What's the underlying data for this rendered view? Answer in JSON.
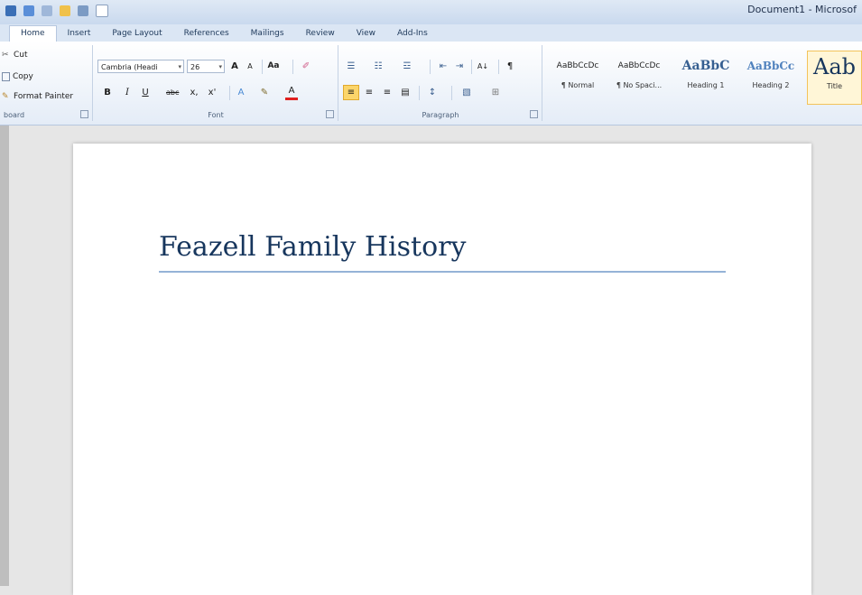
{
  "app": {
    "document_title": "Document1 - Microsof"
  },
  "tabs": [
    "Home",
    "Insert",
    "Page Layout",
    "References",
    "Mailings",
    "Review",
    "View",
    "Add-Ins"
  ],
  "clipboard": {
    "cut": "Cut",
    "copy": "Copy",
    "format_painter": "Format Painter",
    "label": "board"
  },
  "font": {
    "family": "Cambria (Headi",
    "size": "26",
    "grow": "A",
    "shrink": "A",
    "change_case": "Aa",
    "bold": "B",
    "italic": "I",
    "underline": "U",
    "strike": "abc",
    "subscript": "x,",
    "superscript": "x'",
    "label": "Font"
  },
  "paragraph": {
    "label": "Paragraph",
    "sort": "A↓",
    "pilcrow": "¶"
  },
  "styles": [
    {
      "sample": "AaBbCcDc",
      "name": "¶ Normal"
    },
    {
      "sample": "AaBbCcDc",
      "name": "¶ No Spaci..."
    },
    {
      "sample": "AaBbC",
      "name": "Heading 1"
    },
    {
      "sample": "AaBbCc",
      "name": "Heading 2"
    },
    {
      "sample": "Aab",
      "name": "Title"
    }
  ],
  "document": {
    "heading": "Feazell Family History"
  },
  "colors": {
    "heading": "#17365d",
    "rule": "#4f81bd",
    "ribbon_border": "#b6c7df",
    "active_style": "#f3c35a"
  }
}
